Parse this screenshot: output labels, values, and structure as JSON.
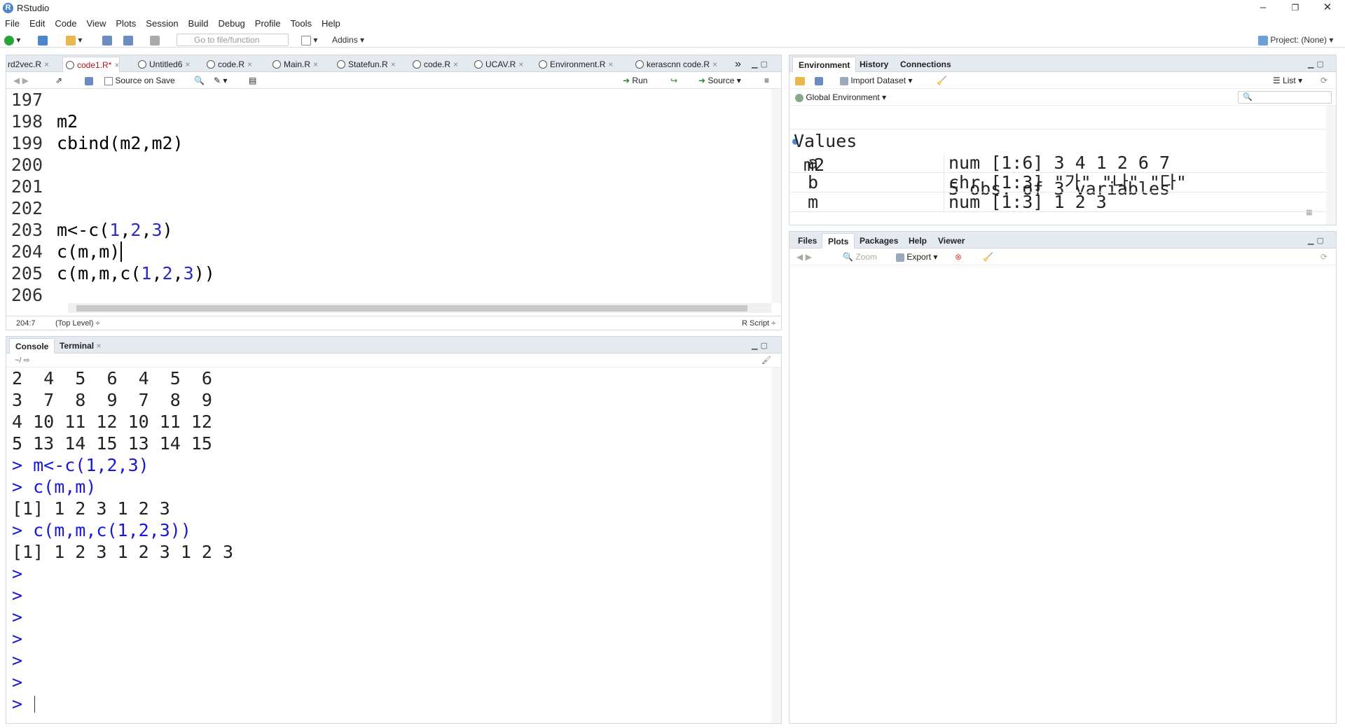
{
  "app": {
    "title": "RStudio",
    "project": "Project: (None)"
  },
  "window_controls": {
    "minimize": "–",
    "maximize": "❐",
    "close": "✕"
  },
  "menu": [
    "File",
    "Edit",
    "Code",
    "View",
    "Plots",
    "Session",
    "Build",
    "Debug",
    "Profile",
    "Tools",
    "Help"
  ],
  "toolbar": {
    "goto_placeholder": "Go to file/function",
    "addins": "Addins"
  },
  "editor": {
    "tabs": [
      {
        "label": "rd2vec.R"
      },
      {
        "label": "code1.R*",
        "active": true
      },
      {
        "label": "Untitled6"
      },
      {
        "label": "code.R"
      },
      {
        "label": "Main.R"
      },
      {
        "label": "Statefun.R"
      },
      {
        "label": "code.R"
      },
      {
        "label": "UCAV.R"
      },
      {
        "label": "Environment.R"
      },
      {
        "label": "kerascnn code.R"
      }
    ],
    "overflow": "»",
    "source_on_save": "Source on Save",
    "run": "Run",
    "source": "Source",
    "lines": [
      {
        "n": "197",
        "code": ""
      },
      {
        "n": "198",
        "code": "m2"
      },
      {
        "n": "199",
        "code": "cbind(m2,m2)"
      },
      {
        "n": "200",
        "code": ""
      },
      {
        "n": "201",
        "code": ""
      },
      {
        "n": "202",
        "code": ""
      },
      {
        "n": "203",
        "code": "m<-c(1,2,3)"
      },
      {
        "n": "204",
        "code": "c(m,m)"
      },
      {
        "n": "205",
        "code": "c(m,m,c(1,2,3))"
      },
      {
        "n": "206",
        "code": ""
      }
    ],
    "status": {
      "position": "204:7",
      "scope": "(Top Level) ÷",
      "type": "R Script ÷"
    }
  },
  "console": {
    "tabs": [
      "Console",
      "Terminal"
    ],
    "path": "~/",
    "lines": [
      {
        "t": "2  4  5  6  4  5  6",
        "cmd": false
      },
      {
        "t": "3  7  8  9  7  8  9",
        "cmd": false
      },
      {
        "t": "4 10 11 12 10 11 12",
        "cmd": false
      },
      {
        "t": "5 13 14 15 13 14 15",
        "cmd": false
      },
      {
        "t": "> m<-c(1,2,3)",
        "cmd": true
      },
      {
        "t": "> c(m,m)",
        "cmd": true
      },
      {
        "t": "[1] 1 2 3 1 2 3",
        "cmd": false
      },
      {
        "t": "> c(m,m,c(1,2,3))",
        "cmd": true
      },
      {
        "t": "[1] 1 2 3 1 2 3 1 2 3",
        "cmd": false
      },
      {
        "t": ">",
        "cmd": true
      },
      {
        "t": ">",
        "cmd": true
      },
      {
        "t": ">",
        "cmd": true
      },
      {
        "t": ">",
        "cmd": true
      },
      {
        "t": ">",
        "cmd": true
      },
      {
        "t": ">",
        "cmd": true
      },
      {
        "t": ">",
        "cmd": true
      }
    ]
  },
  "environment": {
    "tabs": [
      "Environment",
      "History",
      "Connections"
    ],
    "import_dataset": "Import Dataset",
    "list_view": "List",
    "scope": "Global Environment",
    "data_row": {
      "name": "m2",
      "value": "5 obs. of 3 variables"
    },
    "values_header": "Values",
    "values": [
      {
        "name": "a",
        "value": "num [1:6] 3 4 1 2 6 7"
      },
      {
        "name": "b",
        "value": "chr [1:3] \"가\" \"나\" \"다\""
      },
      {
        "name": "m",
        "value": "num [1:3] 1 2 3"
      }
    ]
  },
  "files": {
    "tabs": [
      "Files",
      "Plots",
      "Packages",
      "Help",
      "Viewer"
    ],
    "zoom": "Zoom",
    "export": "Export"
  }
}
